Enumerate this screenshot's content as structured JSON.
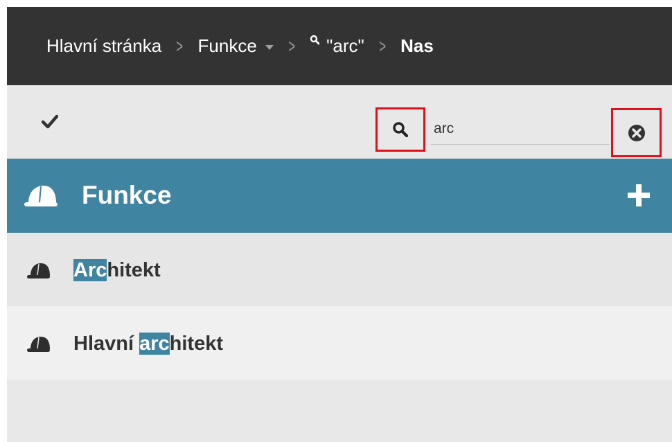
{
  "breadcrumb": {
    "items": [
      {
        "label": "Hlavní stránka"
      },
      {
        "label": "Funkce"
      },
      {
        "label": "\"arc\""
      },
      {
        "label": "Nas"
      }
    ],
    "separator": ">"
  },
  "toolbar": {
    "search_value": "arc"
  },
  "panel": {
    "title": "Funkce",
    "add_label": "+"
  },
  "list": {
    "items": [
      {
        "prefix": "",
        "match": "Arc",
        "suffix": "hitekt"
      },
      {
        "prefix": "Hlavní ",
        "match": "arc",
        "suffix": "hitekt"
      }
    ]
  },
  "colors": {
    "breadcrumb_bg": "#333333",
    "accent": "#3f84a0",
    "highlight_box": "#e0101a",
    "background": "#e8e8e8"
  },
  "icons": {
    "check": "checkmark-icon",
    "search": "search-icon",
    "clear": "clear-circle-icon",
    "header": "hard-hat-icon",
    "add": "plus-icon",
    "row": "hard-hat-icon"
  }
}
